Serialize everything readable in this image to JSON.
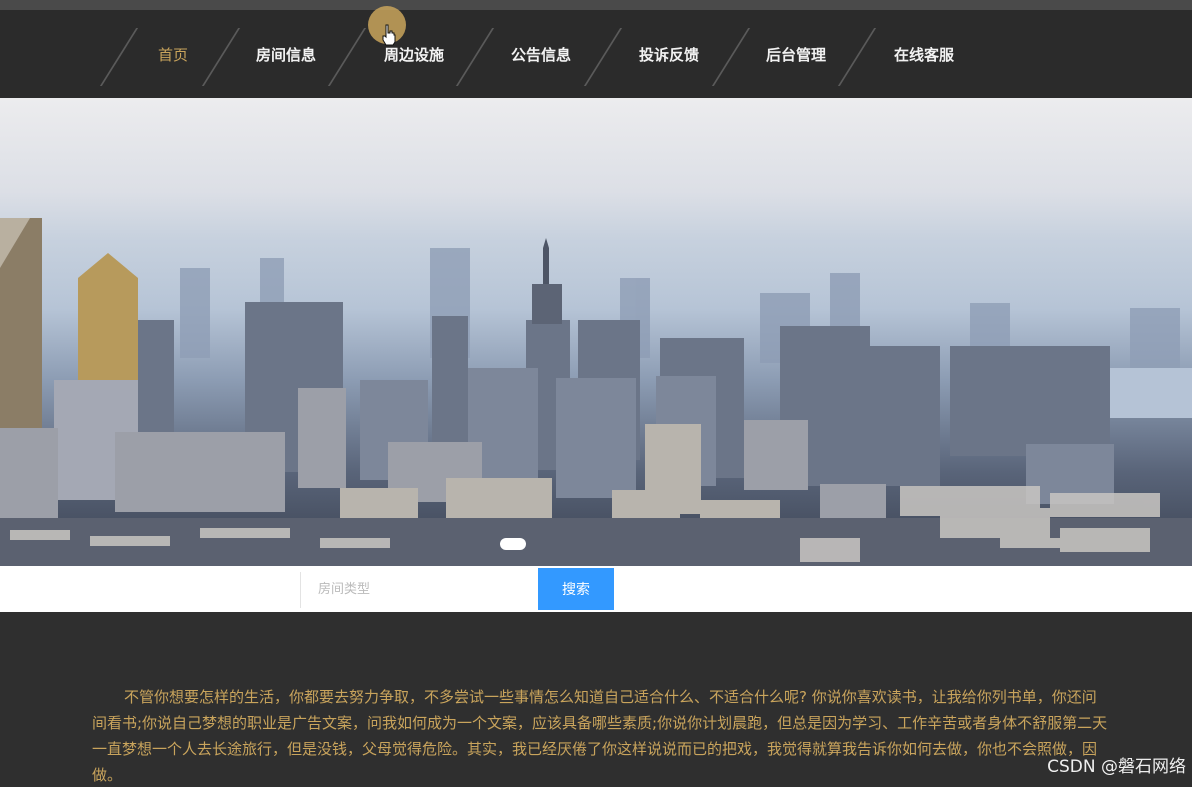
{
  "nav": {
    "items": [
      {
        "label": "首页",
        "active": true
      },
      {
        "label": "房间信息",
        "active": false
      },
      {
        "label": "周边设施",
        "active": false
      },
      {
        "label": "公告信息",
        "active": false
      },
      {
        "label": "投诉反馈",
        "active": false
      },
      {
        "label": "后台管理",
        "active": false
      },
      {
        "label": "在线客服",
        "active": false
      }
    ]
  },
  "search": {
    "placeholder": "房间类型",
    "button_label": "搜索"
  },
  "content": {
    "lines": [
      "不管你想要怎样的生活，你都要去努力争取，不多尝试一些事情怎么知道自己适合什么、不适合什么呢? 你说你喜欢读书，让我给你列书单，你还问",
      "间看书;你说自己梦想的职业是广告文案，问我如何成为一个文案，应该具备哪些素质;你说你计划晨跑，但总是因为学习、工作辛苦或者身体不舒服第二天",
      "一直梦想一个人去长途旅行，但是没钱，父母觉得危险。其实，我已经厌倦了你这样说说而已的把戏，我觉得就算我告诉你如何去做，你也不会照做，因",
      "做。"
    ]
  },
  "watermark": "CSDN @磐石网络",
  "colors": {
    "nav_bg": "#2b2b2b",
    "active": "#c9a45c",
    "search_button": "#3399ff",
    "text_gold": "#c9a45c"
  },
  "icons": [
    "hand-cursor-icon"
  ]
}
